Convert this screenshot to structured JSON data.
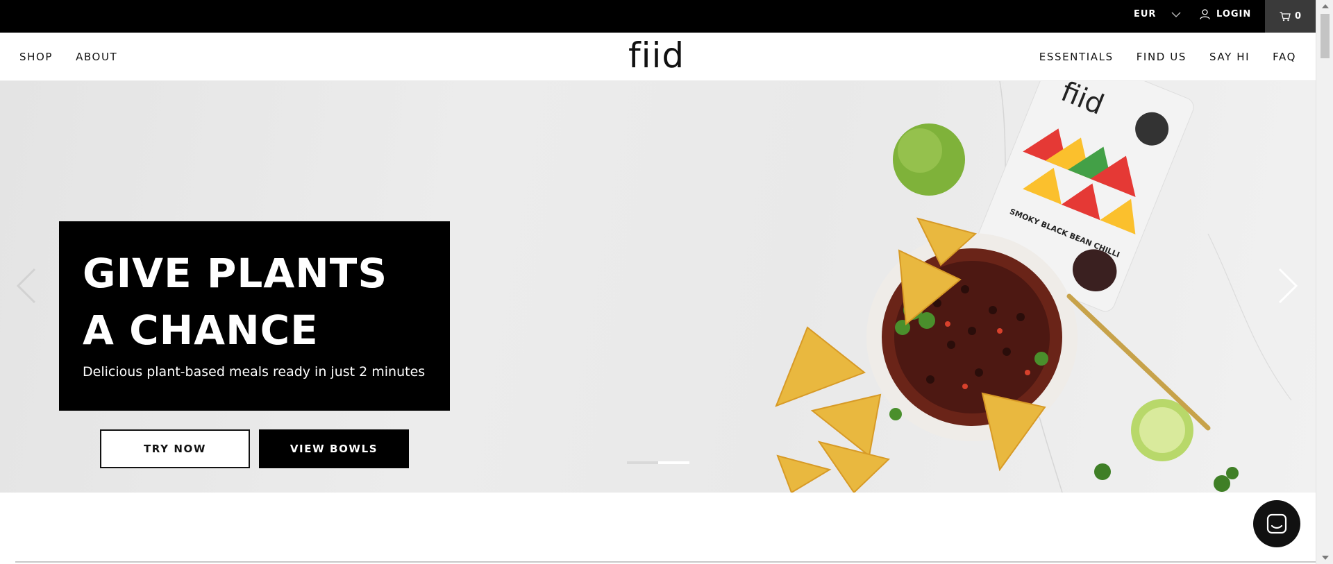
{
  "topbar": {
    "currency": "EUR",
    "login": "LOGIN",
    "cart_count": "0"
  },
  "nav": {
    "logo": "fiid",
    "left_items": [
      "SHOP",
      "ABOUT"
    ],
    "right_items": [
      "ESSENTIALS",
      "FIND US",
      "SAY HI",
      "FAQ"
    ]
  },
  "hero": {
    "title_line1": "GIVE PLANTS",
    "title_line2": "A CHANCE",
    "subtitle": "Delicious plant-based meals ready in just 2 minutes",
    "primary_button": "TRY NOW",
    "secondary_button": "VIEW BOWLS",
    "package_brand": "fiid",
    "package_name": "SMOKY BLACK BEAN CHILLI",
    "slide_count": 2,
    "active_slide": 2
  },
  "colors": {
    "topbar_bg": "#000000",
    "cart_bg": "#3a3a3a",
    "hero_card_bg": "#000000",
    "accent": "#111111"
  },
  "icons": {
    "currency": "chevron-down-icon",
    "login": "user-icon",
    "cart": "cart-icon",
    "prev": "chevron-left-icon",
    "next": "chevron-right-icon",
    "chat": "chat-icon"
  }
}
